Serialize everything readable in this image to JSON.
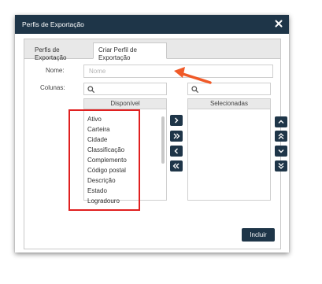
{
  "dialog": {
    "title": "Perfis de Exportação",
    "close_icon": "close-icon"
  },
  "tabs": [
    {
      "label": "Perfis de Exportação",
      "active": false
    },
    {
      "label": "Criar Perfil de Exportação",
      "active": true
    }
  ],
  "form": {
    "name_label": "Nome:",
    "name_placeholder": "Nome",
    "name_value": "",
    "columns_label": "Colunas:"
  },
  "available": {
    "header": "Disponível",
    "search_placeholder": "",
    "items": [
      "Ativo",
      "Carteira",
      "Cidade",
      "Classificação",
      "Complemento",
      "Código postal",
      "Descrição",
      "Estado",
      "Logradouro"
    ]
  },
  "selected": {
    "header": "Selecionadas",
    "search_placeholder": "",
    "items": []
  },
  "move_buttons": [
    "chevron-right-icon",
    "double-chevron-right-icon",
    "chevron-left-icon",
    "double-chevron-left-icon"
  ],
  "order_buttons": [
    "chevron-up-icon",
    "double-chevron-up-icon",
    "chevron-down-icon",
    "double-chevron-down-icon"
  ],
  "include_button": "Incluir",
  "colors": {
    "titlebar": "#1e3548",
    "button": "#1e3548",
    "annotation": "#e02020",
    "arrow": "#f05a28"
  }
}
